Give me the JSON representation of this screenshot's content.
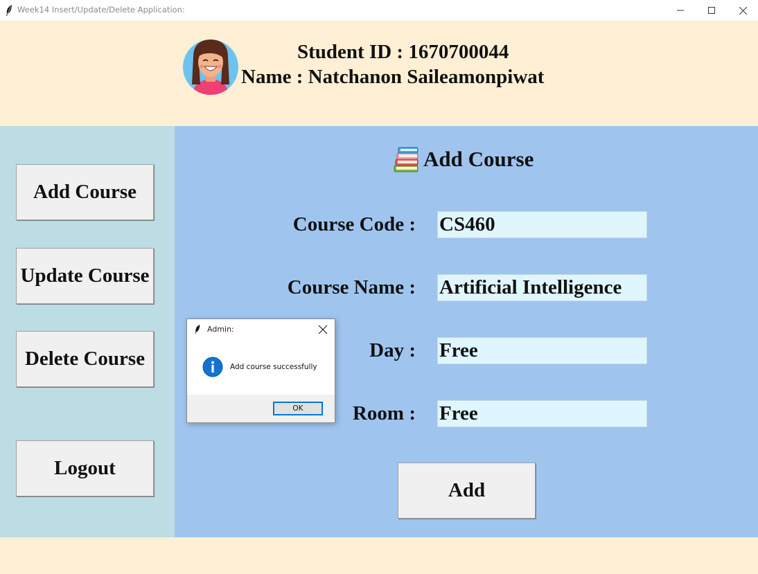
{
  "window": {
    "title": "Week14 Insert/Update/Delete Application:",
    "controls": [
      "minimize-icon",
      "maximize-icon",
      "close-icon"
    ]
  },
  "header": {
    "student_id": "Student ID : 1670700044",
    "student_name": "Name : Natchanon Saileamonpiwat",
    "avatar_icon": "girl-avatar-icon"
  },
  "sidebar": {
    "items": [
      {
        "label": "Add Course"
      },
      {
        "label": "Update Course"
      },
      {
        "label": "Delete Course"
      },
      {
        "label": "Logout"
      }
    ]
  },
  "main": {
    "title": "Add Course",
    "title_icon": "books-icon",
    "fields": [
      {
        "label": "Course Code :",
        "value": "CS460"
      },
      {
        "label": "Course Name :",
        "value": "Artificial Intelligence"
      },
      {
        "label": "Day :",
        "value": "Free"
      },
      {
        "label": "Room :",
        "value": "Free"
      }
    ],
    "add_label": "Add"
  },
  "dialog": {
    "title": "Admin:",
    "message": "Add course successfully",
    "ok_label": "OK",
    "icon": "info-icon"
  },
  "colors": {
    "header_bg": "#ffefd5",
    "sidebar_bg": "#bcdde3",
    "main_bg": "#9fc5ef",
    "input_bg": "#dff6ff",
    "button_bg": "#f0f0f0"
  }
}
